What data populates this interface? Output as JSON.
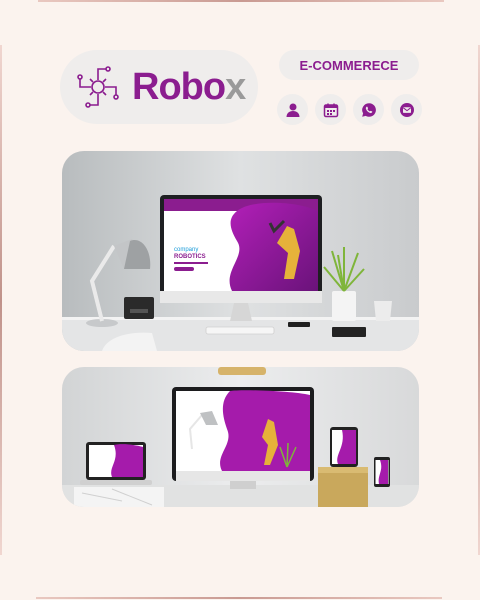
{
  "brand": {
    "name_main": "Robo",
    "name_accent": "x"
  },
  "tagline": "E-COMMERECE",
  "icons": [
    "user-icon",
    "calendar-icon",
    "whatsapp-icon",
    "mail-icon"
  ],
  "colors": {
    "accent": "#8b1d8f",
    "background": "#fbf3ee",
    "pill": "#efedec"
  },
  "screen": {
    "company": "company",
    "headline": "ROBOTICS"
  }
}
